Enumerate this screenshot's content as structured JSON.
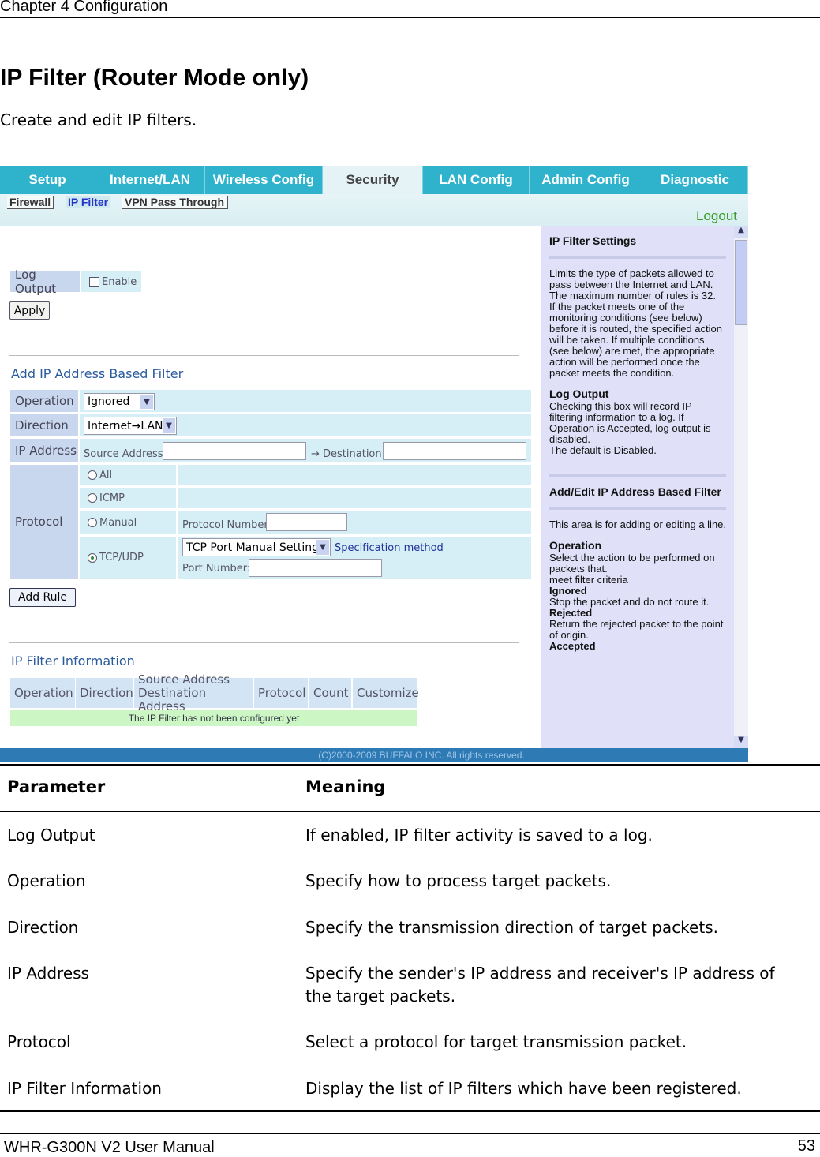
{
  "header": {
    "chapter": "Chapter 4  Configuration",
    "title": "IP Filter (Router Mode only)",
    "subtitle": "Create and edit IP filters."
  },
  "screenshot": {
    "tabs": [
      "Setup",
      "Internet/LAN",
      "Wireless Config",
      "Security",
      "LAN Config",
      "Admin Config",
      "Diagnostic"
    ],
    "active_tab": "Security",
    "subtabs": [
      "Firewall",
      "IP Filter",
      "VPN Pass Through"
    ],
    "active_subtab": "IP Filter",
    "logout": "Logout",
    "log_output": {
      "label": "Log Output",
      "checkbox": "Enable",
      "checked": false
    },
    "apply": "Apply",
    "add_section": "Add IP Address Based Filter",
    "operation": {
      "label": "Operation",
      "value": "Ignored"
    },
    "direction": {
      "label": "Direction",
      "value": "Internet→LAN"
    },
    "ip_address": {
      "label": "IP Address",
      "source": "Source Address:",
      "dest": "→ Destination:"
    },
    "protocol": {
      "label": "Protocol",
      "options": [
        "All",
        "ICMP",
        "Manual",
        "TCP/UDP"
      ],
      "selected": "TCP/UDP",
      "protocol_number": "Protocol Number:",
      "port_select": "TCP Port Manual Setting",
      "spec_link": "Specification method",
      "port_number": "Port Number:"
    },
    "add_rule": "Add Rule",
    "info_section": "IP Filter Information",
    "info_headers": [
      "Operation",
      "Direction",
      "Source Address",
      "Destination Address",
      "Protocol",
      "Count",
      "Customize"
    ],
    "info_empty": "The IP Filter has not been configured yet",
    "copyright": "(C)2000-2009 BUFFALO INC. All rights reserved.",
    "help": {
      "h1": "IP Filter Settings",
      "p1": "Limits the type of packets allowed to pass between the Internet and LAN.",
      "p1b": "The maximum number of rules is 32.",
      "p1c": "If the packet meets one of the monitoring conditions (see below) before it is routed, the specified action will be taken. If multiple conditions (see below) are met, the appropriate action will be performed once the packet meets the condition.",
      "h2": "Log Output",
      "p2": "Checking this box will record IP filtering information to a log. If Operation is Accepted, log output is disabled.",
      "p2b": "The default is Disabled.",
      "h3": "Add/Edit IP Address Based Filter",
      "p3": "This area is for adding or editing a line.",
      "h4": "Operation",
      "p4": "Select the action to be performed on packets that.",
      "p4b": "meet filter criteria",
      "t1": "Ignored",
      "d1": "Stop the packet and do not route it.",
      "t2": "Rejected",
      "d2": "Return the rejected packet to the point of origin.",
      "t3": "Accepted"
    }
  },
  "table": {
    "headers": [
      "Parameter",
      "Meaning"
    ],
    "rows": [
      {
        "parameter": "Log Output",
        "meaning": "If enabled, IP filter activity is saved to a log."
      },
      {
        "parameter": "Operation",
        "meaning": "Specify how to process target packets."
      },
      {
        "parameter": "Direction",
        "meaning": "Specify the transmission direction of target packets."
      },
      {
        "parameter": "IP Address",
        "meaning": "Specify the sender's IP address and receiver's IP address of the target packets."
      },
      {
        "parameter": "Protocol",
        "meaning": "Select a protocol for target transmission packet."
      },
      {
        "parameter": "IP Filter Information",
        "meaning": "Display the list of IP filters which have been registered."
      }
    ]
  },
  "footer": {
    "manual": "WHR-G300N V2 User Manual",
    "page": "53"
  }
}
